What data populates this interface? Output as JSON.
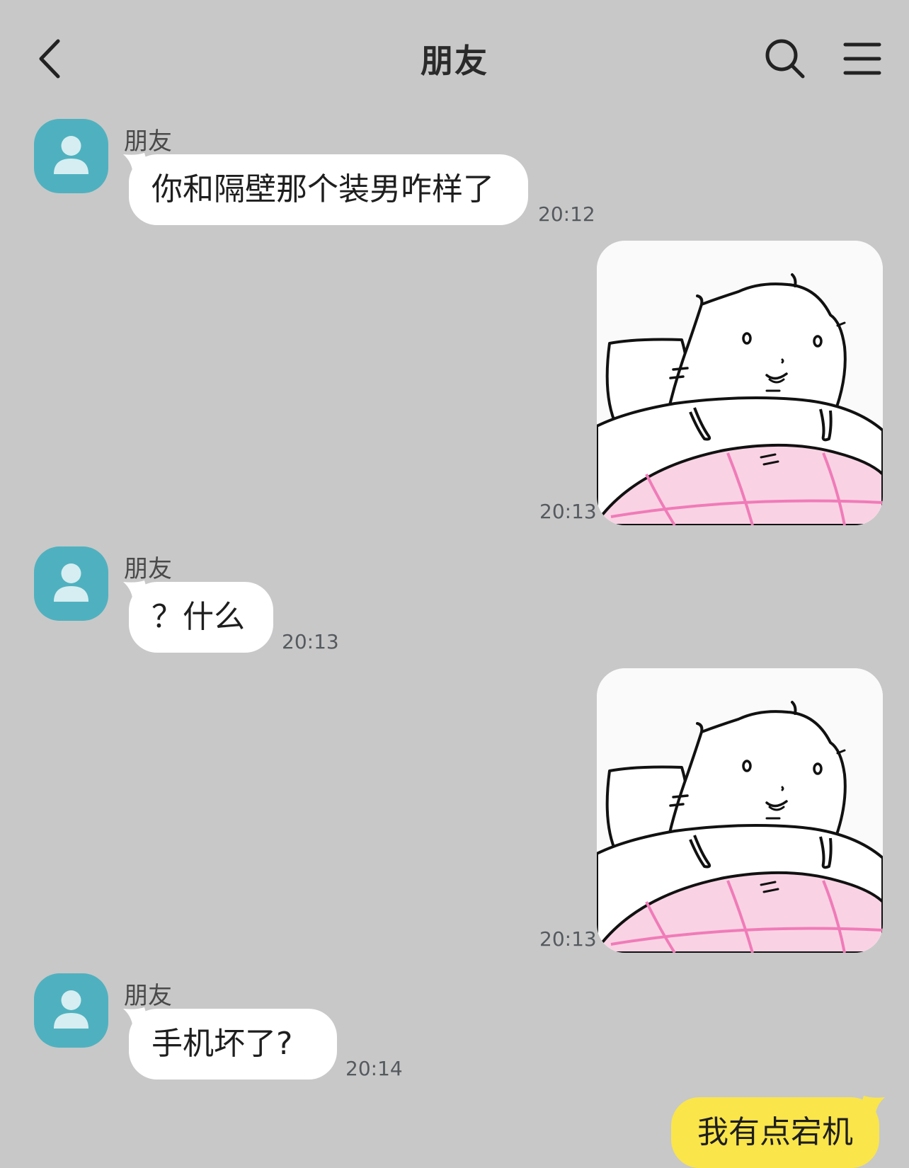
{
  "header": {
    "title": "朋友"
  },
  "messages": [
    {
      "sender": "朋友",
      "type": "text",
      "text": "你和隔壁那个装男咋样了",
      "time": "20:12"
    },
    {
      "sender": "me",
      "type": "sticker",
      "sticker": "sleepy-hamster-in-bed",
      "time": "20:13"
    },
    {
      "sender": "朋友",
      "type": "text",
      "text": "？什么",
      "time": "20:13"
    },
    {
      "sender": "me",
      "type": "sticker",
      "sticker": "sleepy-hamster-in-bed",
      "time": "20:13"
    },
    {
      "sender": "朋友",
      "type": "text",
      "text": "手机坏了?",
      "time": "20:14"
    },
    {
      "sender": "me",
      "type": "text",
      "text": "我有点宕机"
    }
  ],
  "colors": {
    "background": "#c8c8c8",
    "avatar": "#4fb1bf",
    "incoming_bubble": "#ffffff",
    "outgoing_bubble": "#fae54a",
    "blanket_pink": "#f9d3e4",
    "blanket_lines": "#f07bb8"
  },
  "icons": {
    "back": "chevron-left-icon",
    "search": "search-icon",
    "menu": "menu-icon",
    "avatar": "person-icon"
  }
}
